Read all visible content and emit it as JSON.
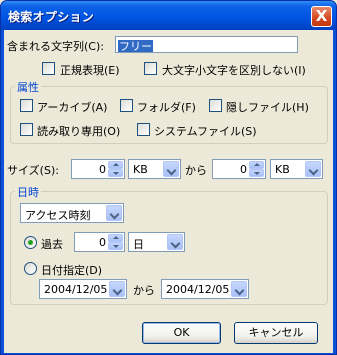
{
  "window": {
    "title": "検索オプション",
    "close_glyph": "X"
  },
  "search_text": {
    "label": "含まれる文字列(C):",
    "value": "フリー",
    "regex_label": "正規表現(E)",
    "case_label": "大文字小文字を区別しない(I)"
  },
  "attributes": {
    "caption": "属性",
    "archive": "アーカイブ(A)",
    "folder": "フォルダ(F)",
    "hidden": "隠しファイル(H)",
    "readonly": "読み取り専用(O)",
    "system": "システムファイル(S)"
  },
  "size": {
    "label": "サイズ(S):",
    "from_value": "0",
    "from_unit": "KB",
    "range_word": "から",
    "to_value": "0",
    "to_unit": "KB"
  },
  "datetime": {
    "caption": "日時",
    "time_type": "アクセス時刻",
    "past_label": "過去",
    "past_value": "0",
    "past_unit": "日",
    "date_spec_label": "日付指定(D)",
    "date_from": "2004/12/05",
    "range_word": "から",
    "date_to": "2004/12/05"
  },
  "buttons": {
    "ok": "OK",
    "cancel": "キャンセル"
  }
}
